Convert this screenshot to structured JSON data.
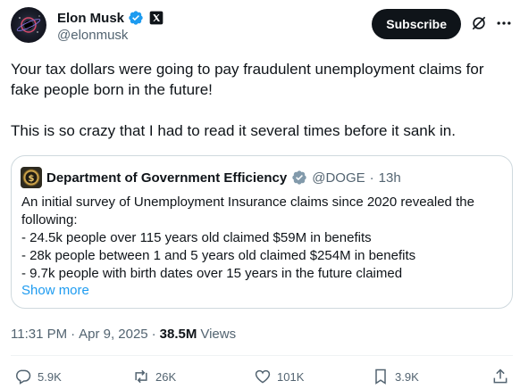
{
  "author": {
    "display_name": "Elon Musk",
    "handle": "@elonmusk"
  },
  "header": {
    "subscribe_label": "Subscribe"
  },
  "post": {
    "paragraphs": [
      "Your tax dollars were going to pay fraudulent unemployment claims for fake people born in the future!",
      "This is so crazy that I had to read it several times before it sank in."
    ]
  },
  "quote": {
    "name": "Department of Government Efficiency",
    "handle": "@DOGE",
    "separator": "·",
    "time": "13h",
    "lines": [
      "An initial survey of Unemployment Insurance claims since 2020 revealed the",
      "following:",
      "- 24.5k people over 115 years old claimed $59M in benefits",
      "- 28k people between 1 and 5 years old claimed $254M in benefits",
      "- 9.7k people with birth dates over 15 years in the future claimed"
    ],
    "show_more": "Show more"
  },
  "meta": {
    "time": "11:31 PM",
    "separator": "·",
    "date": "Apr 9, 2025",
    "views_count": "38.5M",
    "views_label": "Views"
  },
  "actions": {
    "replies": "5.9K",
    "reposts": "26K",
    "likes": "101K",
    "bookmarks": "3.9K"
  },
  "colors": {
    "text": "#0f1419",
    "secondary": "#536471",
    "link": "#1d9bf0",
    "verified_blue": "#1d9bf0",
    "verified_gray": "#829aab",
    "border": "#cfd9de"
  }
}
